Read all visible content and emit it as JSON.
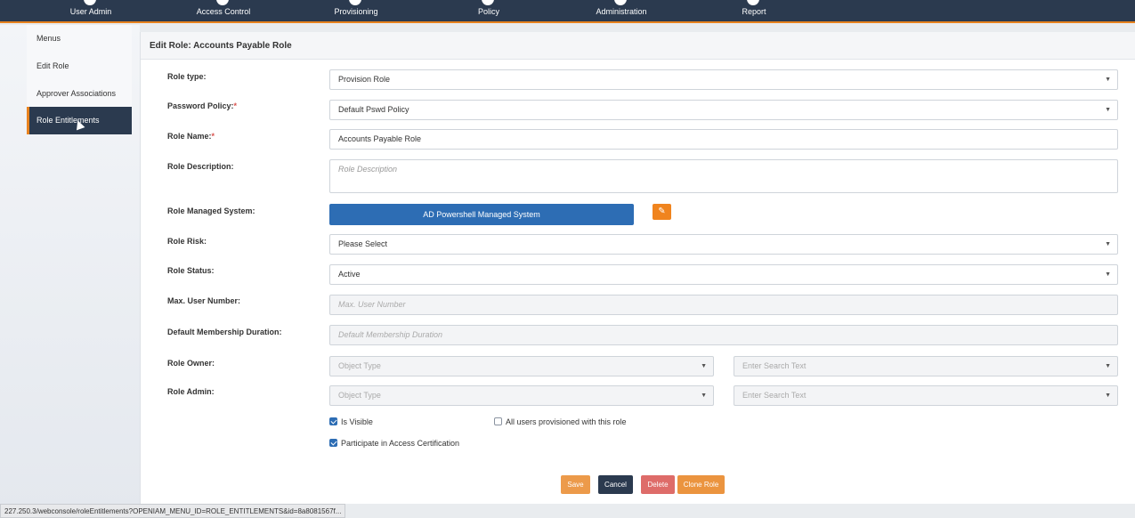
{
  "topnav": {
    "items": [
      {
        "label": "User Admin",
        "icon": "user-icon"
      },
      {
        "label": "Access Control",
        "icon": "key-icon"
      },
      {
        "label": "Provisioning",
        "icon": "provisioning-icon"
      },
      {
        "label": "Policy",
        "icon": "policy-icon"
      },
      {
        "label": "Administration",
        "icon": "gear-icon"
      },
      {
        "label": "Report",
        "icon": "report-icon"
      }
    ],
    "accent_color": "#e8821e",
    "bg_color": "#2b3a4f"
  },
  "sidebar": {
    "items": [
      {
        "label": "Menus"
      },
      {
        "label": "Edit Role"
      },
      {
        "label": "Approver Associations"
      },
      {
        "label": "Role Entitlements",
        "active": true
      }
    ]
  },
  "panel": {
    "title": "Edit Role: Accounts Payable Role"
  },
  "form": {
    "role_type": {
      "label": "Role type:",
      "value": "Provision Role"
    },
    "password_policy": {
      "label": "Password Policy:",
      "required": "*",
      "value": "Default Pswd Policy"
    },
    "role_name": {
      "label": "Role Name:",
      "required": "*",
      "value": "Accounts Payable Role"
    },
    "role_description": {
      "label": "Role Description:",
      "placeholder": "Role Description"
    },
    "role_managed_system": {
      "label": "Role Managed System:",
      "value": "AD Powershell Managed System"
    },
    "role_risk": {
      "label": "Role Risk:",
      "value": "Please Select"
    },
    "role_status": {
      "label": "Role Status:",
      "value": "Active"
    },
    "max_user_number": {
      "label": "Max. User Number:",
      "placeholder": "Max. User Number"
    },
    "default_membership_duration": {
      "label": "Default Membership Duration:",
      "placeholder": "Default Membership Duration"
    },
    "role_owner": {
      "label": "Role Owner:",
      "object_type": "Object Type",
      "search": "Enter Search Text"
    },
    "role_admin": {
      "label": "Role Admin:",
      "object_type": "Object Type",
      "search": "Enter Search Text"
    },
    "checkboxes": {
      "is_visible": {
        "label": "Is Visible",
        "checked": true
      },
      "all_users_provisioned": {
        "label": "All users provisioned with this role",
        "checked": false
      },
      "participate_access_cert": {
        "label": "Participate in Access Certification",
        "checked": true
      }
    }
  },
  "actions": {
    "save": "Save",
    "cancel": "Cancel",
    "delete": "Delete",
    "clone": "Clone Role"
  },
  "statusbar": {
    "url": "227.250.3/webconsole/roleEntitlements?OPENIAM_MENU_ID=ROLE_ENTITLEMENTS&id=8a8081567f..."
  }
}
